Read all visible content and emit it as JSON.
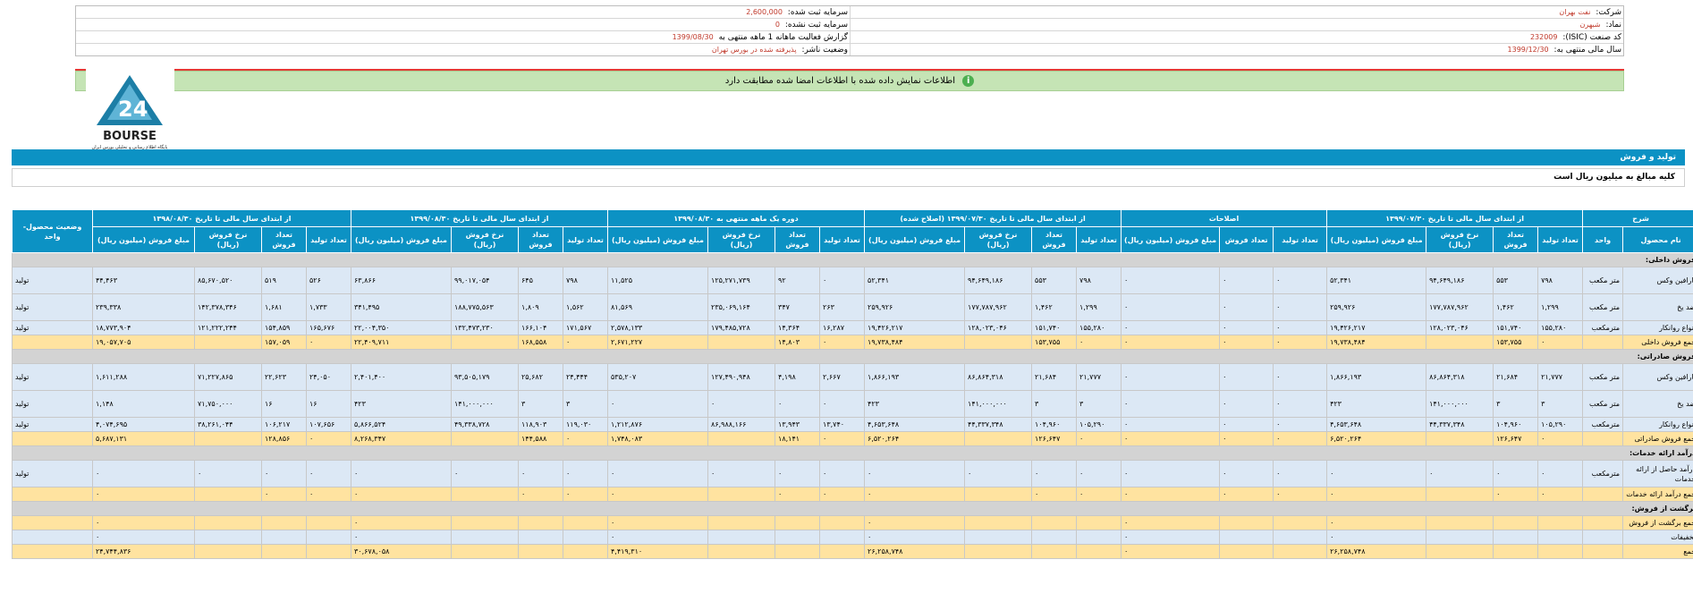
{
  "info": {
    "company_label": "شرکت:",
    "company_value": "نفت بهران",
    "reg_capital_label": "سرمایه ثبت شده:",
    "reg_capital_value": "2,600,000",
    "symbol_label": "نماد:",
    "symbol_value": "شبهرن",
    "unreg_capital_label": "سرمایه ثبت نشده:",
    "unreg_capital_value": "0",
    "isic_label": "کد صنعت (ISIC):",
    "isic_value": "232009",
    "report_label": "گزارش فعالیت ماهانه 1 ماهه منتهی به",
    "report_value": "1399/08/30",
    "fiscal_label": "سال مالی منتهی به:",
    "fiscal_value": "1399/12/30",
    "status_label": "وضعیت ناشر:",
    "status_value": "پذیرفته شده در بورس تهران"
  },
  "notice": {
    "icon": "info-icon",
    "text": "اطلاعات نمایش داده شده با اطلاعات امضا شده مطابقت دارد"
  },
  "logo": {
    "word": "BOURSE",
    "number": "24",
    "tagline": "پایگاه اطلاع رسانی و تحلیلی بورس ایران"
  },
  "section": {
    "title": "تولید و فروش"
  },
  "unit_note": "کلیه مبالغ به میلیون ریال است",
  "table": {
    "group_headers": [
      "شرح",
      "از ابتدای سال مالی تا تاریخ ۱۳۹۹/۰۷/۳۰",
      "اصلاحات",
      "از ابتدای سال مالی تا تاریخ ۱۳۹۹/۰۷/۳۰ (اصلاح شده)",
      "دوره یک ماهه منتهی به ۱۳۹۹/۰۸/۳۰",
      "از ابتدای سال مالی تا تاریخ ۱۳۹۹/۰۸/۳۰",
      "از ابتدای سال مالی تا تاریخ ۱۳۹۸/۰۸/۳۰",
      "وضعیت محصول- واحد"
    ],
    "sub_headers": {
      "desc": [
        "نام محصول",
        "واحد"
      ],
      "full": [
        "تعداد تولید",
        "تعداد فروش",
        "نرخ فروش (ریال)",
        "مبلغ فروش (میلیون ریال)"
      ],
      "corr": [
        "تعداد تولید",
        "تعداد فروش",
        "مبلغ فروش (میلیون ریال)"
      ]
    },
    "rows": [
      {
        "type": "sec",
        "name": "فروش داخلی:"
      },
      {
        "type": "item",
        "h": "tall",
        "name": "پارافین وکس",
        "unit": "متر مکعب",
        "status": "تولید",
        "g1": [
          "۷۹۸",
          "۵۵۳",
          "۹۴,۶۴۹,۱۸۶",
          "۵۲,۳۴۱"
        ],
        "g2": [
          "۰",
          "۰",
          "۰"
        ],
        "g3": [
          "۷۹۸",
          "۵۵۳",
          "۹۴,۶۴۹,۱۸۶",
          "۵۲,۳۴۱"
        ],
        "g4": [
          "۰",
          "۹۲",
          "۱۲۵,۲۷۱,۷۳۹",
          "۱۱,۵۲۵"
        ],
        "g5": [
          "۷۹۸",
          "۶۴۵",
          "۹۹,۰۱۷,۰۵۴",
          "۶۳,۸۶۶"
        ],
        "g6": [
          "۵۲۶",
          "۵۱۹",
          "۸۵,۶۷۰,۵۲۰",
          "۴۴,۴۶۳"
        ]
      },
      {
        "type": "item",
        "h": "tall",
        "name": "ضد یخ",
        "unit": "متر مکعب",
        "status": "تولید",
        "g1": [
          "۱,۲۹۹",
          "۱,۴۶۲",
          "۱۷۷,۷۸۷,۹۶۲",
          "۲۵۹,۹۲۶"
        ],
        "g2": [
          "۰",
          "۰",
          "۰"
        ],
        "g3": [
          "۱,۲۹۹",
          "۱,۴۶۲",
          "۱۷۷,۷۸۷,۹۶۲",
          "۲۵۹,۹۲۶"
        ],
        "g4": [
          "۲۶۳",
          "۳۴۷",
          "۲۳۵,۰۶۹,۱۶۴",
          "۸۱,۵۶۹"
        ],
        "g5": [
          "۱,۵۶۲",
          "۱,۸۰۹",
          "۱۸۸,۷۷۵,۵۶۳",
          "۳۴۱,۴۹۵"
        ],
        "g6": [
          "۱,۷۳۳",
          "۱,۶۸۱",
          "۱۴۲,۳۷۸,۳۴۶",
          "۲۳۹,۳۳۸"
        ]
      },
      {
        "type": "item",
        "h": "short",
        "name": "انواع روانکار",
        "unit": "مترمکعب",
        "status": "تولید",
        "g1": [
          "۱۵۵,۲۸۰",
          "۱۵۱,۷۴۰",
          "۱۲۸,۰۲۳,۰۴۶",
          "۱۹,۴۲۶,۲۱۷"
        ],
        "g2": [
          "۰",
          "۰",
          "۰"
        ],
        "g3": [
          "۱۵۵,۲۸۰",
          "۱۵۱,۷۴۰",
          "۱۲۸,۰۲۳,۰۴۶",
          "۱۹,۴۲۶,۲۱۷"
        ],
        "g4": [
          "۱۶,۲۸۷",
          "۱۴,۳۶۴",
          "۱۷۹,۴۸۵,۷۲۸",
          "۲,۵۷۸,۱۳۳"
        ],
        "g5": [
          "۱۷۱,۵۶۷",
          "۱۶۶,۱۰۴",
          "۱۳۲,۴۷۳,۲۳۰",
          "۲۲,۰۰۴,۳۵۰"
        ],
        "g6": [
          "۱۶۵,۶۷۶",
          "۱۵۴,۸۵۹",
          "۱۲۱,۲۲۲,۲۴۴",
          "۱۸,۷۷۳,۹۰۴"
        ]
      },
      {
        "type": "total",
        "name": "جمع فروش داخلی",
        "unit": "",
        "status": "",
        "g1": [
          "۰",
          "۱۵۳,۷۵۵",
          "",
          "۱۹,۷۳۸,۴۸۴"
        ],
        "g2": [
          "۰",
          "۰",
          "۰"
        ],
        "g3": [
          "۰",
          "۱۵۳,۷۵۵",
          "",
          "۱۹,۷۳۸,۴۸۴"
        ],
        "g4": [
          "۰",
          "۱۴,۸۰۳",
          "",
          "۲,۶۷۱,۲۲۷"
        ],
        "g5": [
          "۰",
          "۱۶۸,۵۵۸",
          "",
          "۲۲,۴۰۹,۷۱۱"
        ],
        "g6": [
          "۰",
          "۱۵۷,۰۵۹",
          "",
          "۱۹,۰۵۷,۷۰۵"
        ]
      },
      {
        "type": "sec",
        "name": "فروش صادراتی:"
      },
      {
        "type": "item",
        "h": "tall",
        "name": "پارافین وکس",
        "unit": "متر مکعب",
        "status": "تولید",
        "g1": [
          "۲۱,۷۷۷",
          "۲۱,۶۸۴",
          "۸۶,۸۶۴,۳۱۸",
          "۱,۸۶۶,۱۹۳"
        ],
        "g2": [
          "۰",
          "۰",
          "۰"
        ],
        "g3": [
          "۲۱,۷۷۷",
          "۲۱,۶۸۴",
          "۸۶,۸۶۴,۳۱۸",
          "۱,۸۶۶,۱۹۳"
        ],
        "g4": [
          "۲,۶۶۷",
          "۴,۱۹۸",
          "۱۲۷,۴۹۰,۹۴۸",
          "۵۳۵,۲۰۷"
        ],
        "g5": [
          "۲۴,۴۴۴",
          "۲۵,۶۸۲",
          "۹۳,۵۰۵,۱۷۹",
          "۲,۴۰۱,۴۰۰"
        ],
        "g6": [
          "۲۴,۰۵۰",
          "۲۲,۶۲۳",
          "۷۱,۲۲۷,۸۶۵",
          "۱,۶۱۱,۲۸۸"
        ]
      },
      {
        "type": "item",
        "h": "tall",
        "name": "ضد یخ",
        "unit": "متر مکعب",
        "status": "تولید",
        "g1": [
          "۳",
          "۳",
          "۱۴۱,۰۰۰,۰۰۰",
          "۴۲۳"
        ],
        "g2": [
          "۰",
          "۰",
          "۰"
        ],
        "g3": [
          "۳",
          "۳",
          "۱۴۱,۰۰۰,۰۰۰",
          "۴۲۳"
        ],
        "g4": [
          "۰",
          "۰",
          "۰",
          "۰"
        ],
        "g5": [
          "۳",
          "۳",
          "۱۴۱,۰۰۰,۰۰۰",
          "۴۲۳"
        ],
        "g6": [
          "۱۶",
          "۱۶",
          "۷۱,۷۵۰,۰۰۰",
          "۱,۱۴۸"
        ]
      },
      {
        "type": "item",
        "h": "short",
        "name": "انواع روانکار",
        "unit": "مترمکعب",
        "status": "تولید",
        "g1": [
          "۱۰۵,۲۹۰",
          "۱۰۴,۹۶۰",
          "۴۴,۳۳۷,۳۴۸",
          "۴,۶۵۳,۶۴۸"
        ],
        "g2": [
          "۰",
          "۰",
          "۰"
        ],
        "g3": [
          "۱۰۵,۲۹۰",
          "۱۰۴,۹۶۰",
          "۴۴,۳۳۷,۳۴۸",
          "۴,۶۵۳,۶۴۸"
        ],
        "g4": [
          "۱۳,۷۴۰",
          "۱۳,۹۴۳",
          "۸۶,۹۸۸,۱۶۶",
          "۱,۲۱۲,۸۷۶"
        ],
        "g5": [
          "۱۱۹,۰۳۰",
          "۱۱۸,۹۰۳",
          "۴۹,۳۳۸,۷۲۸",
          "۵,۸۶۶,۵۲۴"
        ],
        "g6": [
          "۱۰۷,۶۵۶",
          "۱۰۶,۲۱۷",
          "۳۸,۲۶۱,۰۴۴",
          "۴,۰۷۴,۶۹۵"
        ]
      },
      {
        "type": "total",
        "name": "جمع فروش صادراتی",
        "unit": "",
        "status": "",
        "g1": [
          "۰",
          "۱۲۶,۶۴۷",
          "",
          "۶,۵۲۰,۲۶۴"
        ],
        "g2": [
          "۰",
          "۰",
          "۰"
        ],
        "g3": [
          "۰",
          "۱۲۶,۶۴۷",
          "",
          "۶,۵۲۰,۲۶۴"
        ],
        "g4": [
          "۰",
          "۱۸,۱۴۱",
          "",
          "۱,۷۴۸,۰۸۳"
        ],
        "g5": [
          "۰",
          "۱۴۴,۵۸۸",
          "",
          "۸,۲۶۸,۳۴۷"
        ],
        "g6": [
          "۰",
          "۱۲۸,۸۵۶",
          "",
          "۵,۶۸۷,۱۳۱"
        ]
      },
      {
        "type": "sec",
        "name": "درآمد ارائه خدمات:"
      },
      {
        "type": "item",
        "h": "tall",
        "name": "درآمد حاصل از ارائه خدمات",
        "unit": "مترمکعب",
        "status": "تولید",
        "g1": [
          "۰",
          "۰",
          "۰",
          "۰"
        ],
        "g2": [
          "۰",
          "۰",
          "۰"
        ],
        "g3": [
          "۰",
          "۰",
          "۰",
          "۰"
        ],
        "g4": [
          "۰",
          "۰",
          "۰",
          "۰"
        ],
        "g5": [
          "۰",
          "۰",
          "۰",
          "۰"
        ],
        "g6": [
          "۰",
          "۰",
          "۰",
          "۰"
        ]
      },
      {
        "type": "total",
        "name": "جمع درآمد ارائه خدمات",
        "unit": "",
        "status": "",
        "g1": [
          "۰",
          "۰",
          "",
          "۰"
        ],
        "g2": [
          "۰",
          "۰",
          "۰"
        ],
        "g3": [
          "۰",
          "۰",
          "",
          "۰"
        ],
        "g4": [
          "۰",
          "۰",
          "",
          "۰"
        ],
        "g5": [
          "۰",
          "۰",
          "",
          "۰"
        ],
        "g6": [
          "۰",
          "۰",
          "",
          "۰"
        ]
      },
      {
        "type": "sec",
        "name": "برگشت از فروش:"
      },
      {
        "type": "total",
        "name": "جمع برگشت از فروش",
        "unit": "",
        "status": "",
        "g1": [
          "",
          "",
          "",
          "۰"
        ],
        "g2": [
          "",
          "",
          "۰"
        ],
        "g3": [
          "",
          "",
          "",
          "۰"
        ],
        "g4": [
          "",
          "",
          "",
          "۰"
        ],
        "g5": [
          "",
          "",
          "",
          "۰"
        ],
        "g6": [
          "",
          "",
          "",
          "۰"
        ]
      },
      {
        "type": "item",
        "h": "short",
        "name": "تخفیفات",
        "unit": "",
        "status": "",
        "g1": [
          "",
          "",
          "",
          "۰"
        ],
        "g2": [
          "",
          "",
          "۰"
        ],
        "g3": [
          "",
          "",
          "",
          "۰"
        ],
        "g4": [
          "",
          "",
          "",
          "۰"
        ],
        "g5": [
          "",
          "",
          "",
          "۰"
        ],
        "g6": [
          "",
          "",
          "",
          "۰"
        ]
      },
      {
        "type": "total",
        "name": "جمع",
        "unit": "",
        "status": "",
        "g1": [
          "",
          "",
          "",
          "۲۶,۲۵۸,۷۴۸"
        ],
        "g2": [
          "",
          "",
          "۰"
        ],
        "g3": [
          "",
          "",
          "",
          "۲۶,۲۵۸,۷۴۸"
        ],
        "g4": [
          "",
          "",
          "",
          "۴,۴۱۹,۳۱۰"
        ],
        "g5": [
          "",
          "",
          "",
          "۳۰,۶۷۸,۰۵۸"
        ],
        "g6": [
          "",
          "",
          "",
          "۲۴,۷۴۴,۸۳۶"
        ]
      }
    ]
  }
}
